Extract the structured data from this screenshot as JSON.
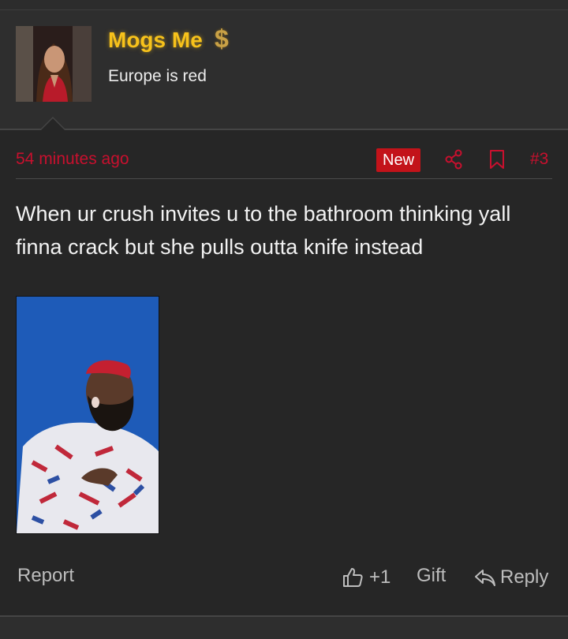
{
  "user": {
    "name": "Mogs Me",
    "title": "Europe is red",
    "badge_icon": "dollar-icon",
    "name_color": "#f7c21b"
  },
  "post": {
    "timestamp": "54 minutes ago",
    "new_label": "New",
    "number": "#3",
    "text": "When ur crush invites u to the bathroom thinking yall finna crack but she pulls outta knife instead",
    "accent_color": "#c8102e"
  },
  "footer": {
    "report_label": "Report",
    "like_count": "+1",
    "gift_label": "Gift",
    "reply_label": "Reply"
  }
}
